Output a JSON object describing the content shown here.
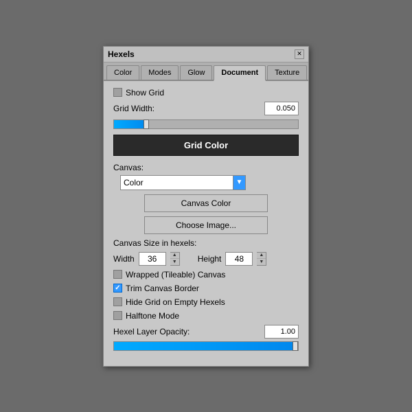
{
  "window": {
    "title": "Hexels",
    "close_label": "✕"
  },
  "tabs": [
    {
      "label": "Color",
      "active": false
    },
    {
      "label": "Modes",
      "active": false
    },
    {
      "label": "Glow",
      "active": false
    },
    {
      "label": "Document",
      "active": true
    },
    {
      "label": "Texture",
      "active": false
    }
  ],
  "content": {
    "show_grid_label": "Show Grid",
    "grid_width_label": "Grid Width:",
    "grid_width_value": "0.050",
    "grid_color_button": "Grid Color",
    "canvas_label": "Canvas:",
    "canvas_select_value": "Color",
    "canvas_color_button": "Canvas Color",
    "choose_image_button": "Choose Image...",
    "canvas_size_label": "Canvas Size in hexels:",
    "width_label": "Width",
    "width_value": "36",
    "height_label": "Height",
    "height_value": "48",
    "wrapped_label": "Wrapped (Tileable) Canvas",
    "trim_label": "Trim Canvas Border",
    "hide_grid_label": "Hide Grid on Empty Hexels",
    "halftone_label": "Halftone Mode",
    "opacity_label": "Hexel Layer Opacity:",
    "opacity_value": "1.00"
  },
  "colors": {
    "slider_active": "#00aaff",
    "tab_active_bg": "#c8c8c8",
    "big_button_bg": "#2a2a2a",
    "select_arrow_bg": "#3399ff"
  }
}
